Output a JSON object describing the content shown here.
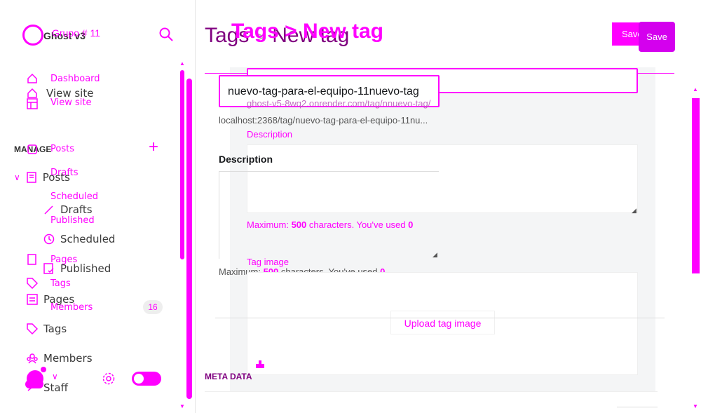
{
  "sidebar": {
    "site_name_a": "Grupo # 11",
    "site_name_b": "Ghost v3",
    "manage_label": "MANAGE",
    "layer1": {
      "view_site": "View site",
      "posts": "Posts",
      "drafts": "Drafts",
      "scheduled": "Scheduled",
      "published": "Published",
      "pages": "Pages",
      "tags": "Tags",
      "members": "Members",
      "staff": "Staff"
    },
    "layer2": {
      "dashboard": "Dashboard",
      "view_site": "View site",
      "posts": "Posts",
      "drafts": "Drafts",
      "scheduled": "Scheduled",
      "published": "Published",
      "pages": "Pages",
      "tags": "Tags",
      "members": "Members",
      "members_count": "16"
    }
  },
  "header": {
    "breadcrumb_a": "Tags",
    "breadcrumb_sep": ">",
    "breadcrumb_b": "New tag",
    "overlay_title": "Tags > New tag",
    "save_label": "Save",
    "save_label_short": "Save"
  },
  "form_layer1": {
    "name_value": "nuevo-tag-para-el-equipo-11nuevo-tag",
    "url_preview": "localhost:2368/tag/nuevo-tag-para-el-equipo-11nu...",
    "description_label": "Description",
    "max_prefix": "Maximum: ",
    "max_count": "500",
    "max_suffix": " characters. You've used ",
    "used_count": "0",
    "meta_data_label": "META DATA"
  },
  "form_layer2": {
    "slug_value": "nnuevo-tag",
    "url_preview": "ghost-v5-8wq2.onrender.com/tag/nnuevo-tag/",
    "description_label": "Description",
    "max_prefix": "Maximum: ",
    "max_count": "500",
    "max_suffix": " characters. You've used ",
    "used_count": "0",
    "tag_image_label": "Tag image",
    "upload_label": "Upload tag image"
  },
  "colors": {
    "accent": "#ff00ff",
    "panel": "#f4f5f6"
  }
}
